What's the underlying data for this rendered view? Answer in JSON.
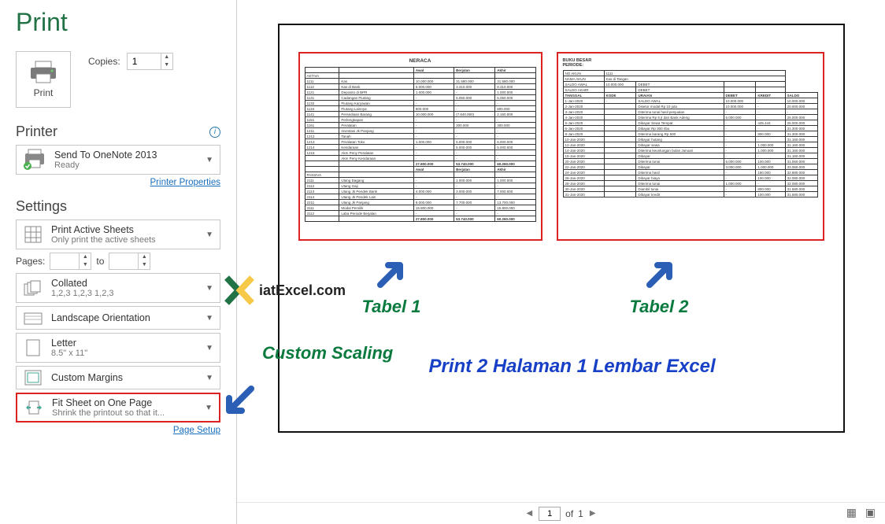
{
  "title": "Print",
  "print_button": "Print",
  "copies": {
    "label": "Copies:",
    "value": "1"
  },
  "printer": {
    "heading": "Printer",
    "name": "Send To OneNote 2013",
    "status": "Ready",
    "properties_link": "Printer Properties"
  },
  "settings": {
    "heading": "Settings",
    "active_sheets": {
      "title": "Print Active Sheets",
      "sub": "Only print the active sheets"
    },
    "pages": {
      "label": "Pages:",
      "to": "to",
      "from": "",
      "to_val": ""
    },
    "collated": {
      "title": "Collated",
      "sub": "1,2,3   1,2,3   1,2,3"
    },
    "orientation": {
      "title": "Landscape Orientation"
    },
    "paper": {
      "title": "Letter",
      "sub": "8.5\" x 11\""
    },
    "margins": {
      "title": "Custom Margins"
    },
    "scaling": {
      "title": "Fit Sheet on One Page",
      "sub": "Shrink the printout so that it..."
    },
    "page_setup_link": "Page Setup"
  },
  "annotations": {
    "custom_scaling": "Custom Scaling",
    "tabel1": "Tabel 1",
    "tabel2": "Tabel 2",
    "main": "Print 2 Halaman 1 Lembar Excel",
    "logo_text": "iatExcel.com"
  },
  "pager": {
    "current": "1",
    "of_label": "of",
    "total": "1"
  },
  "preview": {
    "table1_title": "NERACA",
    "table2_title": "BUKU BESAR",
    "table2_sub": "PERIODE:"
  }
}
